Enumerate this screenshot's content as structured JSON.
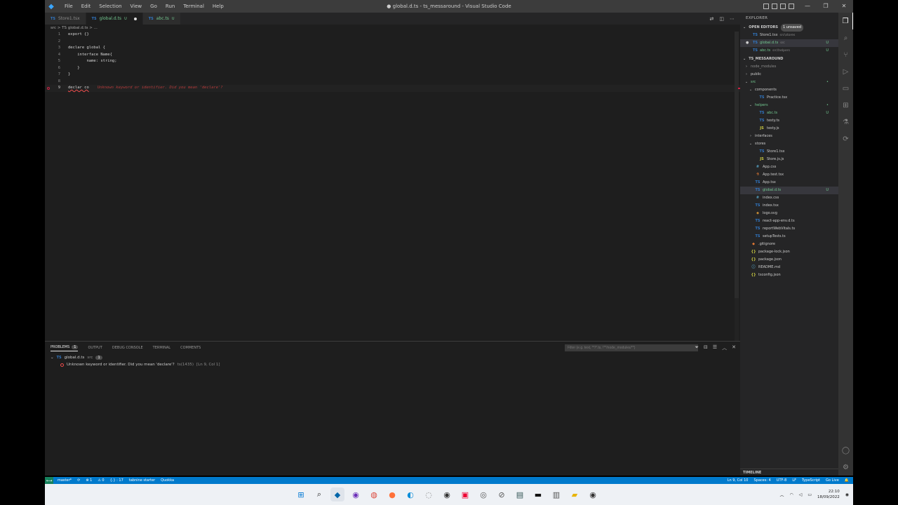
{
  "window": {
    "title": "● global.d.ts - ts_messaround - Visual Studio Code",
    "menu": [
      "File",
      "Edit",
      "Selection",
      "View",
      "Go",
      "Run",
      "Terminal",
      "Help"
    ]
  },
  "tabs": [
    {
      "name": "Store1.tsx",
      "icon": "TS",
      "state": ""
    },
    {
      "name": "global.d.ts",
      "icon": "TS",
      "state": "U",
      "active": true,
      "dirty": true
    },
    {
      "name": "abc.ts",
      "icon": "TS",
      "state": "U"
    }
  ],
  "breadcrumb": "src > TS global.d.ts > ...",
  "editor": {
    "lines": [
      {
        "n": "1",
        "text": "export {}"
      },
      {
        "n": "2",
        "text": ""
      },
      {
        "n": "3",
        "text": "declare global {"
      },
      {
        "n": "4",
        "text": "    interface Name{"
      },
      {
        "n": "5",
        "text": "        name: string;"
      },
      {
        "n": "6",
        "text": "    }"
      },
      {
        "n": "7",
        "text": "}"
      },
      {
        "n": "8",
        "text": ""
      },
      {
        "n": "9",
        "text": "declar co"
      }
    ],
    "inline_error": "Unknown keyword or identifier. Did you mean 'declare'?"
  },
  "panel": {
    "tabs": [
      "PROBLEMS",
      "OUTPUT",
      "DEBUG CONSOLE",
      "TERMINAL",
      "COMMENTS"
    ],
    "problems_count": "1",
    "filter_placeholder": "Filter (e.g. text, **/*.ts, !**/node_modules/**)",
    "file": {
      "name": "global.d.ts",
      "path": "src",
      "count": "1"
    },
    "problem": {
      "message": "Unknown keyword or identifier. Did you mean 'declare'?",
      "source": "ts(1435)",
      "loc": "[Ln 9, Col 1]"
    }
  },
  "explorer": {
    "header": "EXPLORER",
    "open_editors_title": "OPEN EDITORS",
    "unsaved": "1 unsaved",
    "open_editors": [
      {
        "name": "Store1.tsx",
        "path": "src\\stores",
        "status": ""
      },
      {
        "name": "global.d.ts",
        "path": "src",
        "status": "U",
        "active": true
      },
      {
        "name": "abc.ts",
        "path": "src\\helpers",
        "status": "U"
      }
    ],
    "project_title": "TS_MESSAROUND",
    "tree": [
      {
        "depth": 0,
        "chev": "›",
        "name": "node_modules",
        "icon": "",
        "color": "#8c8c8c"
      },
      {
        "depth": 0,
        "chev": "›",
        "name": "public",
        "icon": "",
        "color": "#cccccc"
      },
      {
        "depth": 0,
        "chev": "⌄",
        "name": "src",
        "icon": "",
        "color": "#73c991",
        "status": "•"
      },
      {
        "depth": 1,
        "chev": "⌄",
        "name": "components",
        "icon": "",
        "color": "#cccccc"
      },
      {
        "depth": 2,
        "chev": "",
        "name": "Practice.tsx",
        "icon": "TS",
        "color": "#cccccc"
      },
      {
        "depth": 1,
        "chev": "⌄",
        "name": "helpers",
        "icon": "",
        "color": "#73c991",
        "status": "•"
      },
      {
        "depth": 2,
        "chev": "",
        "name": "abc.ts",
        "icon": "TS",
        "color": "#73c991",
        "status": "U"
      },
      {
        "depth": 2,
        "chev": "",
        "name": "testy.ts",
        "icon": "TS",
        "color": "#cccccc"
      },
      {
        "depth": 2,
        "chev": "",
        "name": "testy.js",
        "icon": "JS",
        "color": "#cccccc"
      },
      {
        "depth": 1,
        "chev": "›",
        "name": "interfaces",
        "icon": "",
        "color": "#cccccc"
      },
      {
        "depth": 1,
        "chev": "⌄",
        "name": "stores",
        "icon": "",
        "color": "#cccccc"
      },
      {
        "depth": 2,
        "chev": "",
        "name": "Store1.tsx",
        "icon": "TS",
        "color": "#cccccc"
      },
      {
        "depth": 2,
        "chev": "",
        "name": "Store.js.js",
        "icon": "JS",
        "color": "#cccccc"
      },
      {
        "depth": 1,
        "chev": "",
        "name": "App.css",
        "icon": "#",
        "color": "#cccccc"
      },
      {
        "depth": 1,
        "chev": "",
        "name": "App.test.tsx",
        "icon": "⚗",
        "color": "#cccccc"
      },
      {
        "depth": 1,
        "chev": "",
        "name": "App.tsx",
        "icon": "TS",
        "color": "#cccccc"
      },
      {
        "depth": 1,
        "chev": "",
        "name": "global.d.ts",
        "icon": "TS",
        "color": "#73c991",
        "status": "U",
        "selected": true
      },
      {
        "depth": 1,
        "chev": "",
        "name": "index.css",
        "icon": "#",
        "color": "#cccccc"
      },
      {
        "depth": 1,
        "chev": "",
        "name": "index.tsx",
        "icon": "TS",
        "color": "#cccccc"
      },
      {
        "depth": 1,
        "chev": "",
        "name": "logo.svg",
        "icon": "◈",
        "color": "#cccccc"
      },
      {
        "depth": 1,
        "chev": "",
        "name": "react-app-env.d.ts",
        "icon": "TS",
        "color": "#cccccc"
      },
      {
        "depth": 1,
        "chev": "",
        "name": "reportWebVitals.ts",
        "icon": "TS",
        "color": "#cccccc"
      },
      {
        "depth": 1,
        "chev": "",
        "name": "setupTests.ts",
        "icon": "TS",
        "color": "#cccccc"
      },
      {
        "depth": 0,
        "chev": "",
        "name": ".gitignore",
        "icon": "◆",
        "color": "#cccccc"
      },
      {
        "depth": 0,
        "chev": "",
        "name": "package-lock.json",
        "icon": "{}",
        "color": "#cccccc"
      },
      {
        "depth": 0,
        "chev": "",
        "name": "package.json",
        "icon": "{}",
        "color": "#cccccc"
      },
      {
        "depth": 0,
        "chev": "",
        "name": "README.md",
        "icon": "ⓘ",
        "color": "#cccccc"
      },
      {
        "depth": 0,
        "chev": "",
        "name": "tsconfig.json",
        "icon": "{}",
        "color": "#cccccc"
      }
    ],
    "timeline": "TIMELINE"
  },
  "statusbar": {
    "branch": "master*",
    "errors": "⊗ 1",
    "warnings": "⚠ 0",
    "extra": "{.} : 17",
    "tabnine": "tabnine starter",
    "quokka": "Quokka",
    "position": "Ln 9, Col 10",
    "spaces": "Spaces: 4",
    "encoding": "UTF-8",
    "eol": "LF",
    "language": "TypeScript",
    "golive": "Go Live"
  },
  "taskbar": {
    "time": "22:10",
    "date": "18/09/2022"
  },
  "colors": {
    "statusbar": "#007acc",
    "editor_bg": "#1e1e1e",
    "sidebar_bg": "#252526",
    "error": "#f14c4c",
    "git_untracked": "#73c991"
  }
}
